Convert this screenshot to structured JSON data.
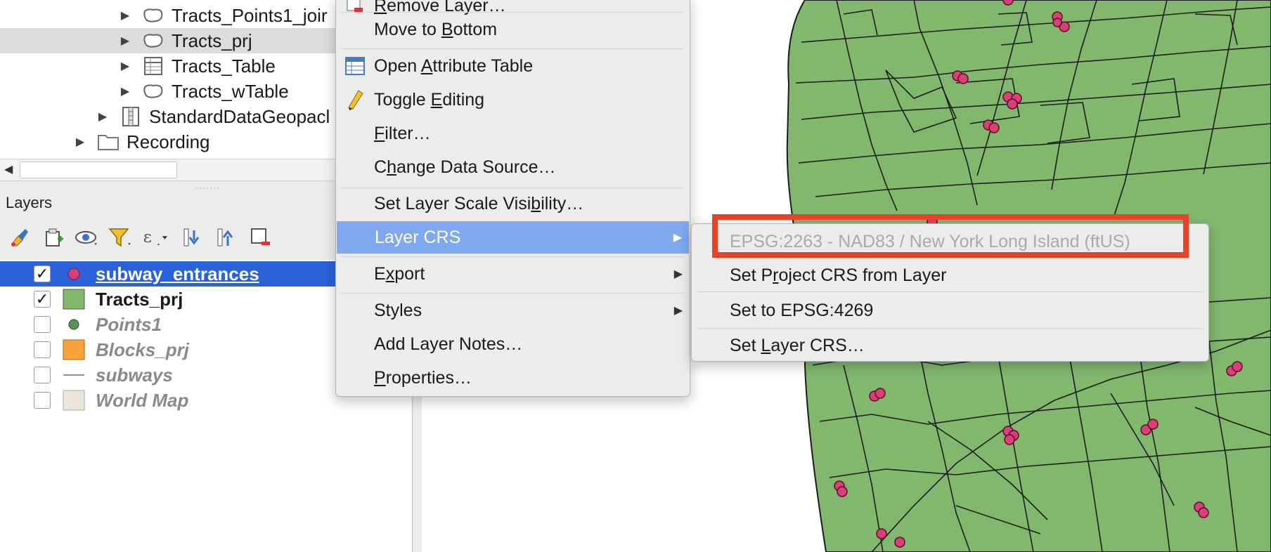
{
  "browser_tree": {
    "items": [
      {
        "label": "Tracts_Points1_joir",
        "icon": "polygon-layer-icon",
        "indent": 2,
        "selected": false
      },
      {
        "label": "Tracts_prj",
        "icon": "polygon-layer-icon",
        "indent": 2,
        "selected": true
      },
      {
        "label": "Tracts_Table",
        "icon": "table-layer-icon",
        "indent": 2,
        "selected": false
      },
      {
        "label": "Tracts_wTable",
        "icon": "polygon-layer-icon",
        "indent": 2,
        "selected": false
      },
      {
        "label": "StandardDataGeopacl",
        "icon": "geopackage-icon",
        "indent": 1,
        "selected": false
      },
      {
        "label": "Recording",
        "icon": "folder-icon",
        "indent": 0,
        "selected": false
      }
    ]
  },
  "layers_panel": {
    "title": "Layers",
    "toolbar_icons": [
      "style-manager-icon",
      "add-group-icon",
      "visibility-icon",
      "filter-legend-icon",
      "filter-expression-icon",
      "expand-all-icon",
      "collapse-all-icon",
      "remove-layer-icon"
    ],
    "layers": [
      {
        "name": "subway_entrances",
        "checked": true,
        "symbol": "pink-point-icon",
        "selected": true,
        "visible": true
      },
      {
        "name": "Tracts_prj",
        "checked": true,
        "symbol": "green-fill-icon",
        "selected": false,
        "visible": true
      },
      {
        "name": "Points1",
        "checked": false,
        "symbol": "green-point-icon",
        "selected": false,
        "visible": false
      },
      {
        "name": "Blocks_prj",
        "checked": false,
        "symbol": "orange-fill-icon",
        "selected": false,
        "visible": false
      },
      {
        "name": "subways",
        "checked": false,
        "symbol": "line-icon",
        "selected": false,
        "visible": false
      },
      {
        "name": "World Map",
        "checked": false,
        "symbol": "beige-fill-icon",
        "selected": false,
        "visible": false
      }
    ]
  },
  "context_menu": {
    "items": [
      {
        "label": "Remove Layer…",
        "icon": "remove-layer-icon",
        "shortcut_index": 0
      },
      {
        "label": "Move to Bottom",
        "shortcut_index": 8
      },
      {
        "label": "Open Attribute Table",
        "icon": "attribute-table-icon",
        "shortcut_index": 5
      },
      {
        "label": "Toggle Editing",
        "icon": "pencil-icon",
        "shortcut_index": 7
      },
      {
        "label": "Filter…",
        "shortcut_index": 0
      },
      {
        "label": "Change Data Source…",
        "shortcut_index": 1
      },
      {
        "label": "Set Layer Scale Visibility…",
        "shortcut_index": 20
      },
      {
        "label": "Layer CRS",
        "submenu": true,
        "active": true
      },
      {
        "label": "Export",
        "submenu": true,
        "shortcut_index": 1
      },
      {
        "label": "Styles",
        "submenu": true
      },
      {
        "label": "Add Layer Notes…"
      },
      {
        "label": "Properties…",
        "shortcut_index": 0
      }
    ]
  },
  "submenu": {
    "items": [
      {
        "label": "EPSG:2263 - NAD83 / New York Long Island (ftUS)",
        "disabled": true
      },
      {
        "label": "Set Project CRS from Layer",
        "shortcut_index": 5
      },
      {
        "label": "Set to EPSG:4269"
      },
      {
        "label": "Set Layer CRS…",
        "shortcut_index": 4
      }
    ]
  },
  "colors": {
    "map_fill": "#82b86e",
    "map_stroke": "#1c1c1c",
    "point_fill": "#d9407a",
    "selection_blue": "#2962d9",
    "menu_active": "#7fa8ee",
    "highlight_red": "#e8432a"
  }
}
